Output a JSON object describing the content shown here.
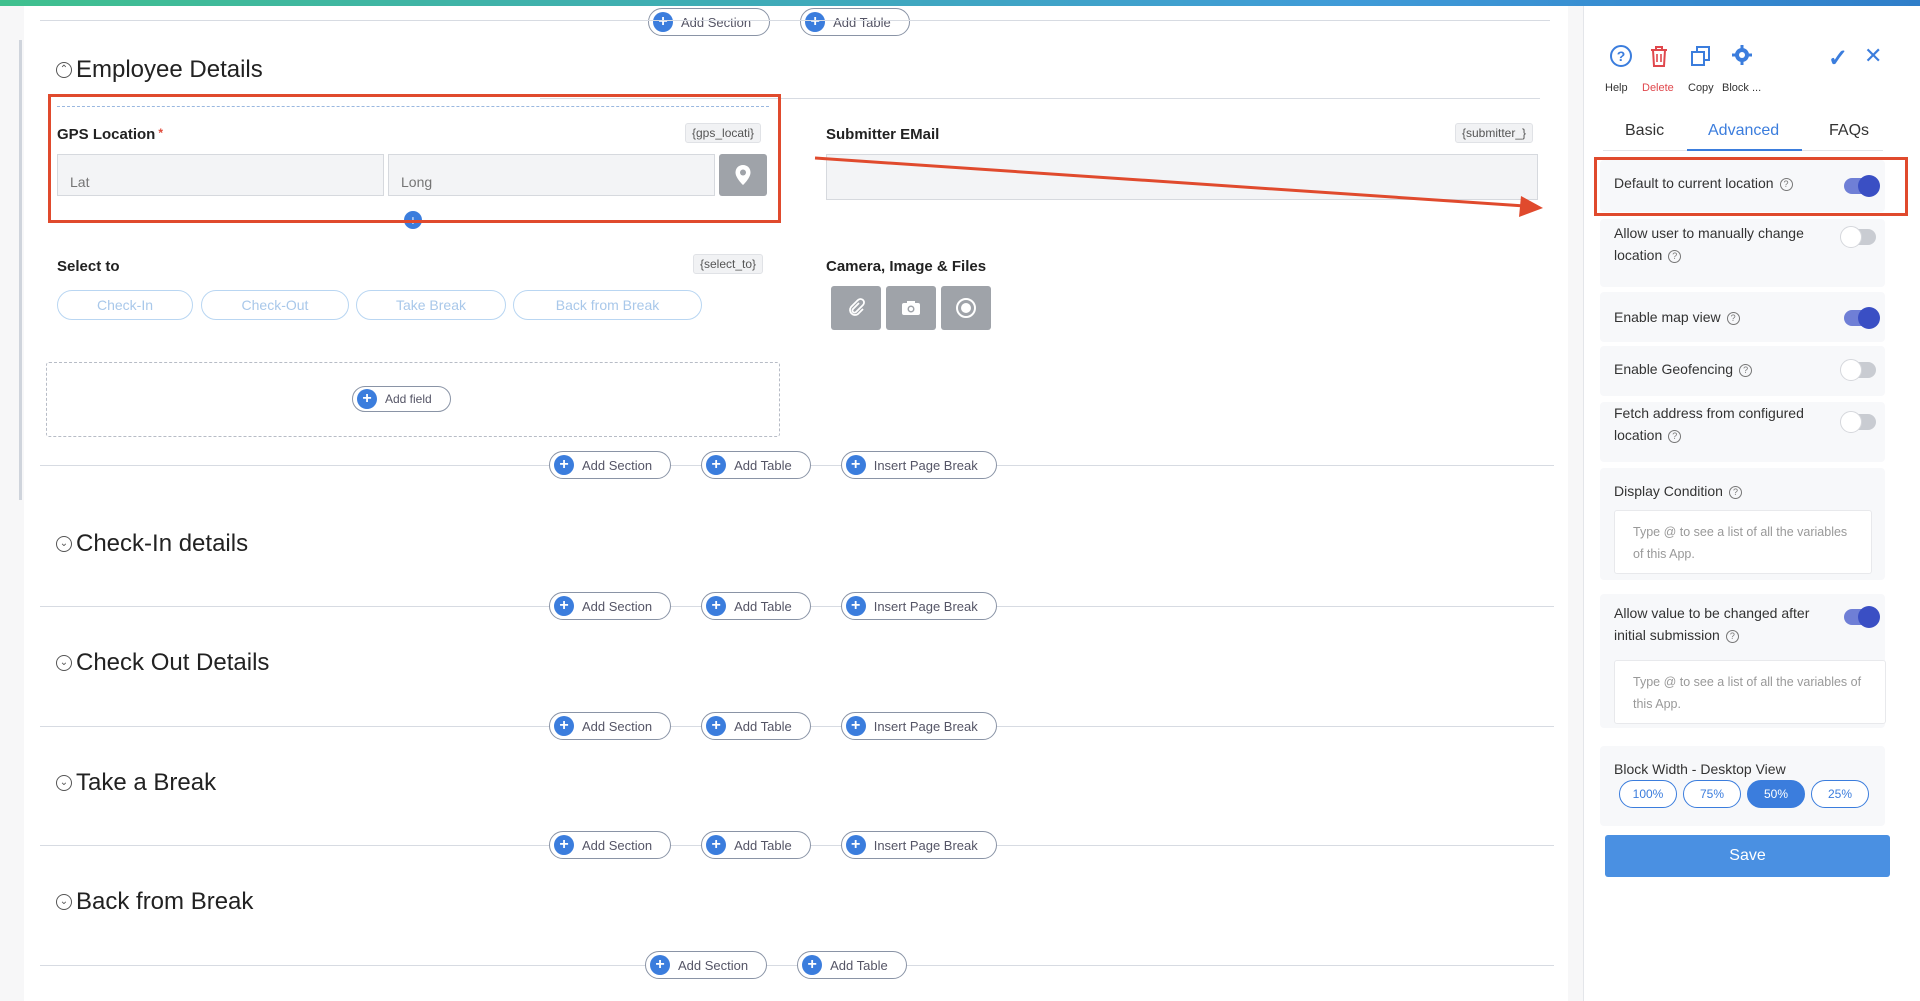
{
  "colors": {
    "accent": "#3b7ddd",
    "annotation": "#e04a2d",
    "delete": "#e0474c"
  },
  "pill_labels": {
    "add_section": "Add Section",
    "add_table": "Add Table",
    "insert_page_break": "Insert Page Break",
    "add_field": "Add field"
  },
  "sections": {
    "employee": "Employee Details",
    "checkin": "Check-In details",
    "checkout": "Check Out Details",
    "take_break": "Take a Break",
    "back_break": "Back from Break"
  },
  "fields": {
    "gps": {
      "label": "GPS Location",
      "required_mark": "*",
      "tag": "{gps_locati}",
      "lat_placeholder": "Lat",
      "long_placeholder": "Long"
    },
    "submitter": {
      "label": "Submitter EMail",
      "tag": "{submitter_}"
    },
    "select_to": {
      "label": "Select to",
      "tag": "{select_to}",
      "options": [
        "Check-In",
        "Check-Out",
        "Take Break",
        "Back from Break"
      ]
    },
    "camera": {
      "label": "Camera, Image & Files"
    }
  },
  "sidebar": {
    "header": {
      "help": "Help",
      "delete": "Delete",
      "copy": "Copy",
      "block": "Block ..."
    },
    "tabs": [
      "Basic",
      "Advanced",
      "FAQs"
    ],
    "active_tab": "Advanced",
    "settings": {
      "default_location": {
        "label": "Default to current location",
        "on": true
      },
      "manual_change": {
        "label": "Allow user to manually change location",
        "on": false
      },
      "map_view": {
        "label": "Enable map view",
        "on": true
      },
      "geofencing": {
        "label": "Enable Geofencing",
        "on": false
      },
      "fetch_address": {
        "label": "Fetch address from configured location",
        "on": false
      },
      "allow_change": {
        "label": "Allow value to be changed after initial submission",
        "on": true
      }
    },
    "display_condition": {
      "label": "Display Condition",
      "placeholder": "Type @ to see a list of all the variables of this App."
    },
    "allow_change_placeholder": "Type @ to see a list of all the variables of this App.",
    "block_width": {
      "label": "Block Width - Desktop View",
      "options": [
        "100%",
        "75%",
        "50%",
        "25%"
      ],
      "selected": "50%"
    },
    "save": "Save"
  }
}
